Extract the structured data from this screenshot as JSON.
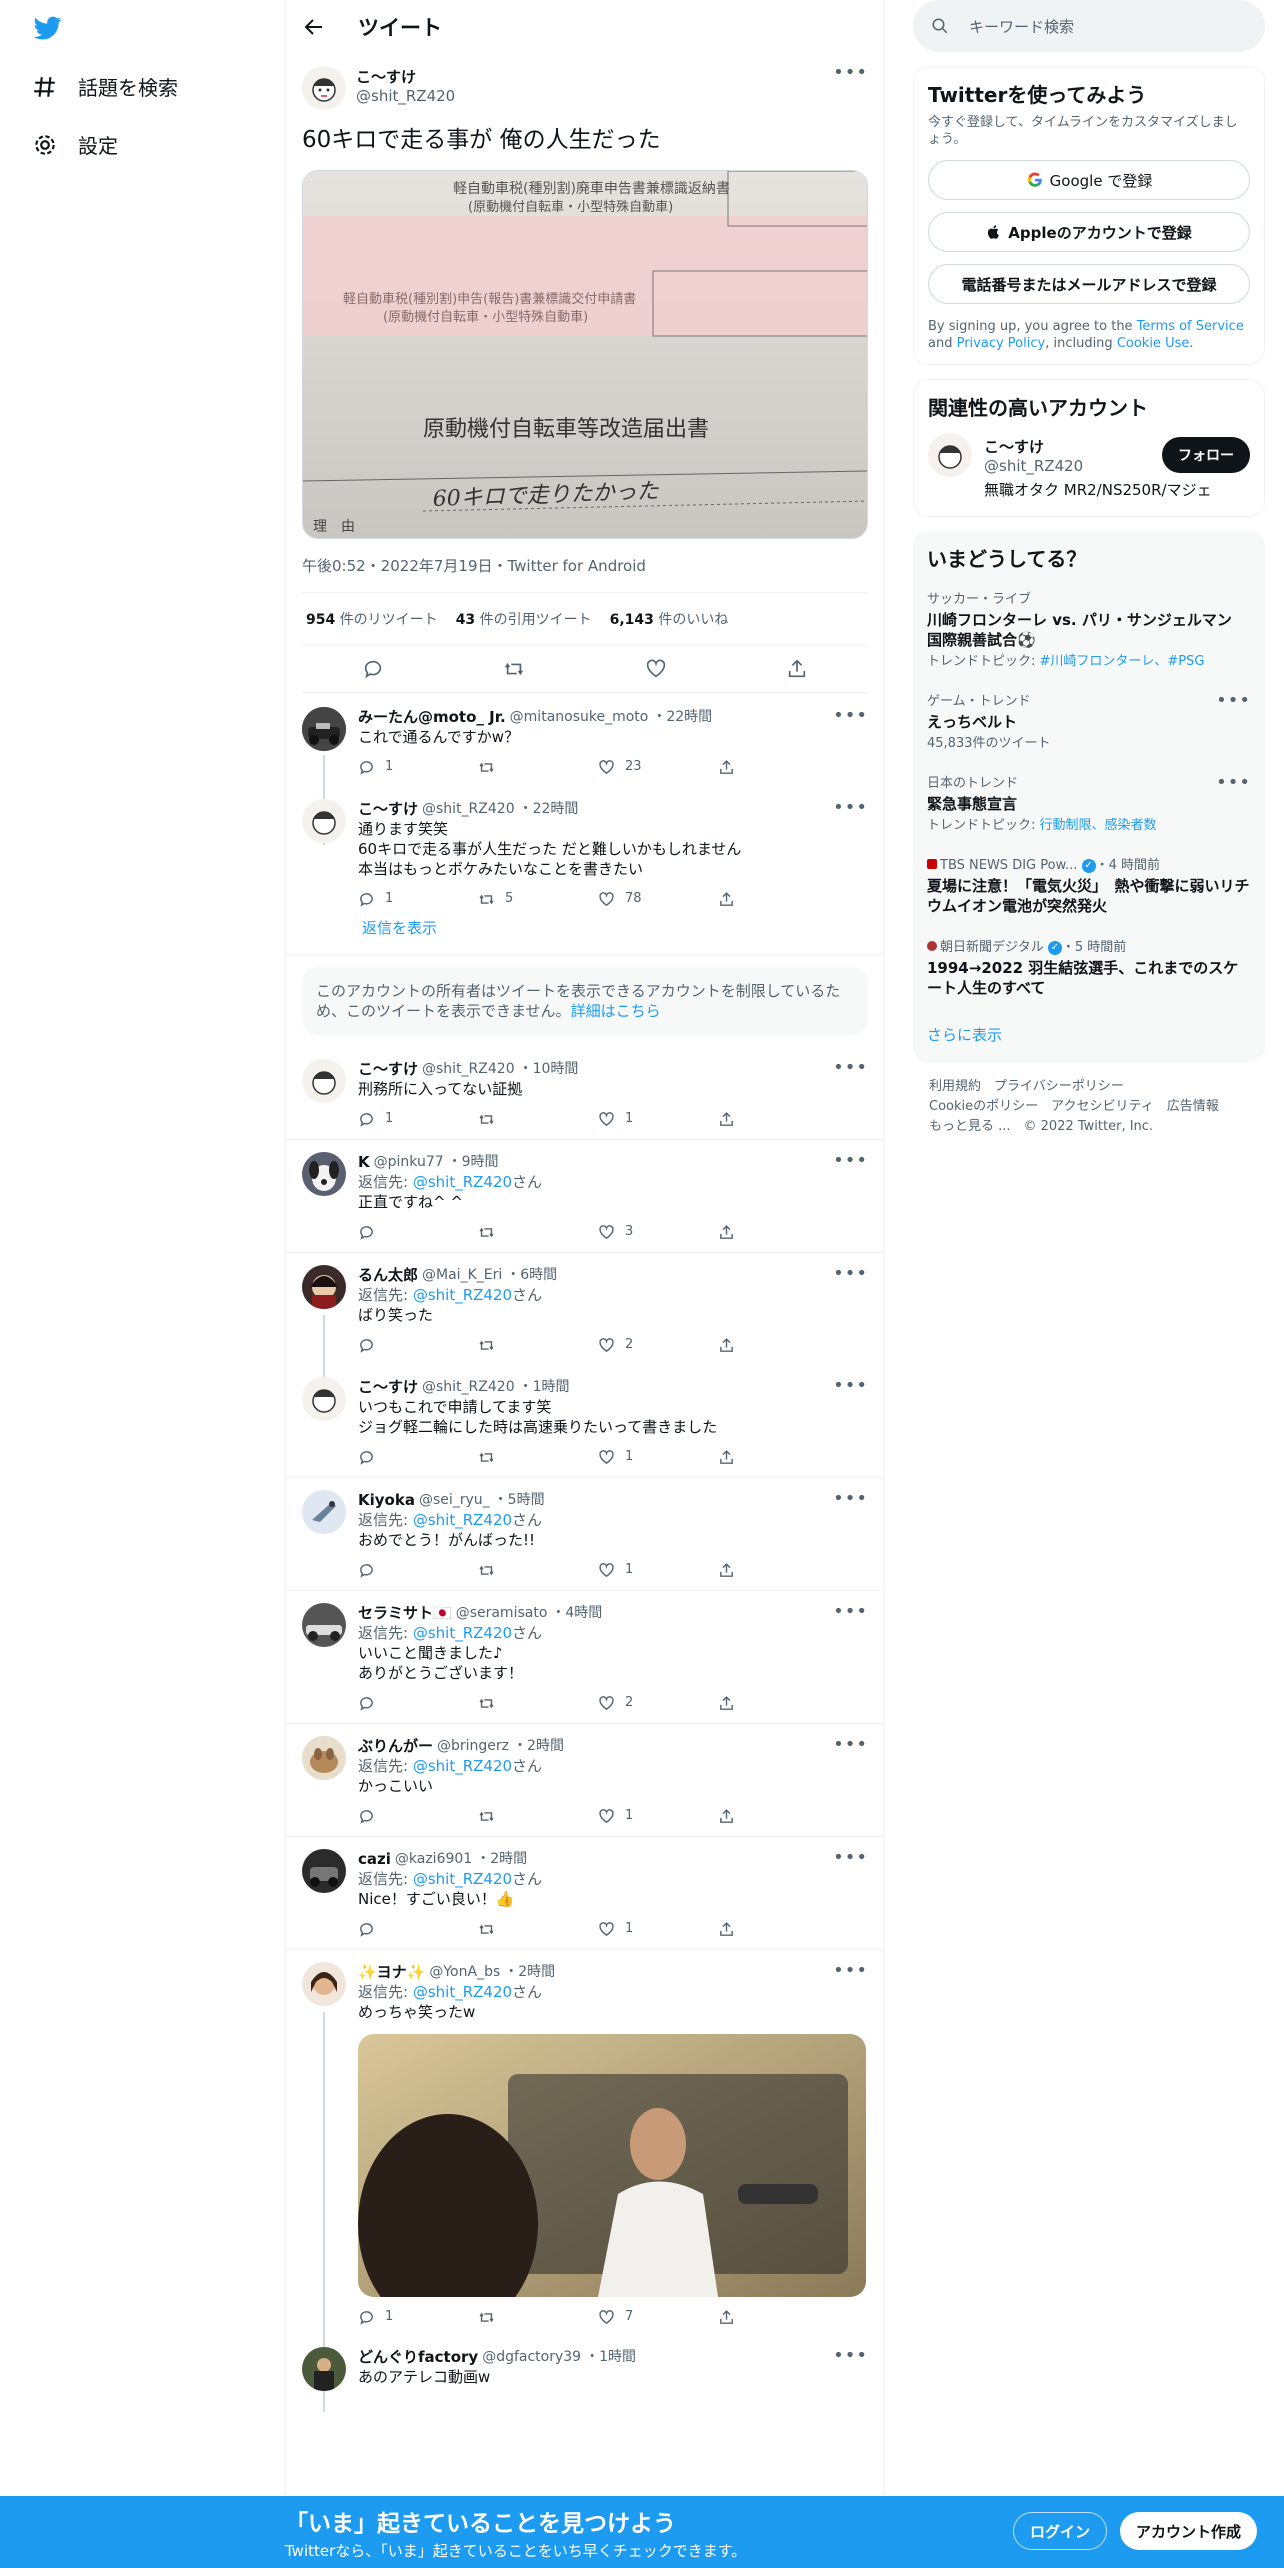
{
  "nav": {
    "explore": "話題を検索",
    "settings": "設定"
  },
  "header": {
    "title": "ツイート"
  },
  "main": {
    "name": "こ〜すけ",
    "handle": "@shit_RZ420",
    "text": "60キロで走る事が 俺の人生だった",
    "meta": "午後0:52・2022年7月19日・Twitter for Android",
    "retweets": "954",
    "retweets_label": "件のリツイート",
    "quotes": "43",
    "quotes_label": "件の引用ツイート",
    "likes": "6,143",
    "likes_label": "件のいいね",
    "image_text": {
      "l1": "軽自動車税(種別割)廃車申告書兼標識返納書",
      "l2": "(原動機付自転車・小型特殊自動車)",
      "l3": "軽自動車税(種別割)申告(報告)書兼標識交付申請書",
      "l4": "(原動機付自転車・小型特殊自動車)",
      "l5": "原動機付自転車等改造届出書",
      "l6": "理　由",
      "hand": "60キロで走りたかった"
    }
  },
  "replies": [
    {
      "name": "みーたん@moto_ Jr.",
      "handle": "@mitanosuke_moto",
      "time": "・22時間",
      "replyto_pre": "",
      "text": "これで通るんですかw？",
      "reply": "1",
      "rt": "",
      "like": "23"
    },
    {
      "name": "こ〜すけ",
      "handle": "@shit_RZ420",
      "time": "・22時間",
      "lines": [
        "通ります笑笑",
        "60キロで走る事が人生だった だと難しいかもしれません",
        "本当はもっとボケみたいなことを書きたい"
      ],
      "reply": "1",
      "rt": "5",
      "like": "78"
    },
    {
      "name": "こ〜すけ",
      "handle": "@shit_RZ420",
      "time": "・10時間",
      "text": "刑務所に入ってない証拠",
      "reply": "1",
      "rt": "",
      "like": "1"
    },
    {
      "name": "K",
      "handle": "@pinku77",
      "time": "・9時間",
      "text": "正直ですね^ ^",
      "reply": "",
      "rt": "",
      "like": "3"
    },
    {
      "name": "るん太郎",
      "handle": "@Mai_K_Eri",
      "time": "・6時間",
      "text": "ばり笑った",
      "reply": "",
      "rt": "",
      "like": "2"
    },
    {
      "name": "こ〜すけ",
      "handle": "@shit_RZ420",
      "time": "・1時間",
      "lines": [
        "いつもこれで申請してます笑",
        "ジョグ軽二輪にした時は高速乗りたいって書きました"
      ],
      "reply": "",
      "rt": "",
      "like": "1"
    },
    {
      "name": "Kiyoka",
      "handle": "@sei_ryu_",
      "time": "・5時間",
      "text": "おめでとう！がんばった!!",
      "reply": "",
      "rt": "",
      "like": "1"
    },
    {
      "name": "セラミサト🇯🇵",
      "handle": "@seramisato",
      "time": "・4時間",
      "lines": [
        "いいこと聞きました♪",
        "ありがとうございます！"
      ],
      "reply": "",
      "rt": "",
      "like": "2"
    },
    {
      "name": "ぶりんがー",
      "handle": "@bringerz",
      "time": "・2時間",
      "text": "かっこいい",
      "reply": "",
      "rt": "",
      "like": "1"
    },
    {
      "name": "cazi",
      "handle": "@kazi6901",
      "time": "・2時間",
      "text": "Nice！すごい良い！👍",
      "reply": "",
      "rt": "",
      "like": "1"
    },
    {
      "name": "✨ヨナ✨",
      "handle": "@YonA_bs",
      "time": "・2時間",
      "text": "めっちゃ笑ったw",
      "reply": "1",
      "rt": "",
      "like": "7"
    },
    {
      "name": "どんぐりfactory",
      "handle": "@dgfactory39",
      "time": "・1時間",
      "text": "あのアテレコ動画w"
    }
  ],
  "replyto": {
    "pre": "返信先: ",
    "handle": "@shit_RZ420",
    "post": "さん"
  },
  "show_replies": "返信を表示",
  "restricted": {
    "text": "このアカウントの所有者はツイートを表示できるアカウントを制限しているため、このツイートを表示できません。",
    "link": "詳細はこちら"
  },
  "search": {
    "placeholder": "キーワード検索"
  },
  "signup": {
    "title": "Twitterを使ってみよう",
    "sub": "今すぐ登録して、タイムラインをカスタマイズしましょう。",
    "google": "Google で登録",
    "apple": "Appleのアカウントで登録",
    "phone": "電話番号またはメールアドレスで登録",
    "terms_pre": "By signing up, you agree to the ",
    "terms": "Terms of Service",
    "and": " and ",
    "privacy": "Privacy Policy",
    "including": ", including ",
    "cookie": "Cookie Use",
    "end": "."
  },
  "related": {
    "title": "関連性の高いアカウント",
    "name": "こ〜すけ",
    "handle": "@shit_RZ420",
    "bio": "無職オタク MR2/NS250R/マジェ",
    "follow": "フォロー"
  },
  "trends": {
    "title": "いまどうしてる？",
    "items": [
      {
        "cat": "サッカー・ライブ",
        "t": "川崎フロンターレ vs. パリ・サンジェルマン 国際親善試合⚽",
        "n_pre": "トレンドトピック: ",
        "n_link": "#川崎フロンターレ、#PSG"
      },
      {
        "cat": "ゲーム・トレンド",
        "t": "えっちベルト",
        "n": "45,833件のツイート"
      },
      {
        "cat": "日本のトレンド",
        "t": "緊急事態宣言",
        "n_pre": "トレンドトピック: ",
        "n_link": "行動制限、感染者数"
      },
      {
        "cat": "TBS NEWS DIG Pow...",
        "time": "・4 時間前",
        "t": "夏場に注意！「電気火災」　熱や衝撃に弱いリチウムイオン電池が突然発火"
      },
      {
        "cat": "朝日新聞デジタル",
        "time": "・5 時間前",
        "t": "1994→2022 羽生結弦選手、これまでのスケート人生のすべて"
      }
    ],
    "more": "さらに表示"
  },
  "footer": {
    "l1": "利用規約　プライバシーポリシー",
    "l2": "Cookieのポリシー　アクセシビリティ　広告情報",
    "l3": "もっと見る ...　© 2022 Twitter, Inc."
  },
  "banner": {
    "title": "「いま」起きていることを見つけよう",
    "sub": "Twitterなら、「いま」起きていることをいち早くチェックできます。",
    "login": "ログイン",
    "signup": "アカウント作成"
  },
  "colors": {
    "accent": "#1d9bf0",
    "text": "#0f1419",
    "muted": "#536471"
  }
}
